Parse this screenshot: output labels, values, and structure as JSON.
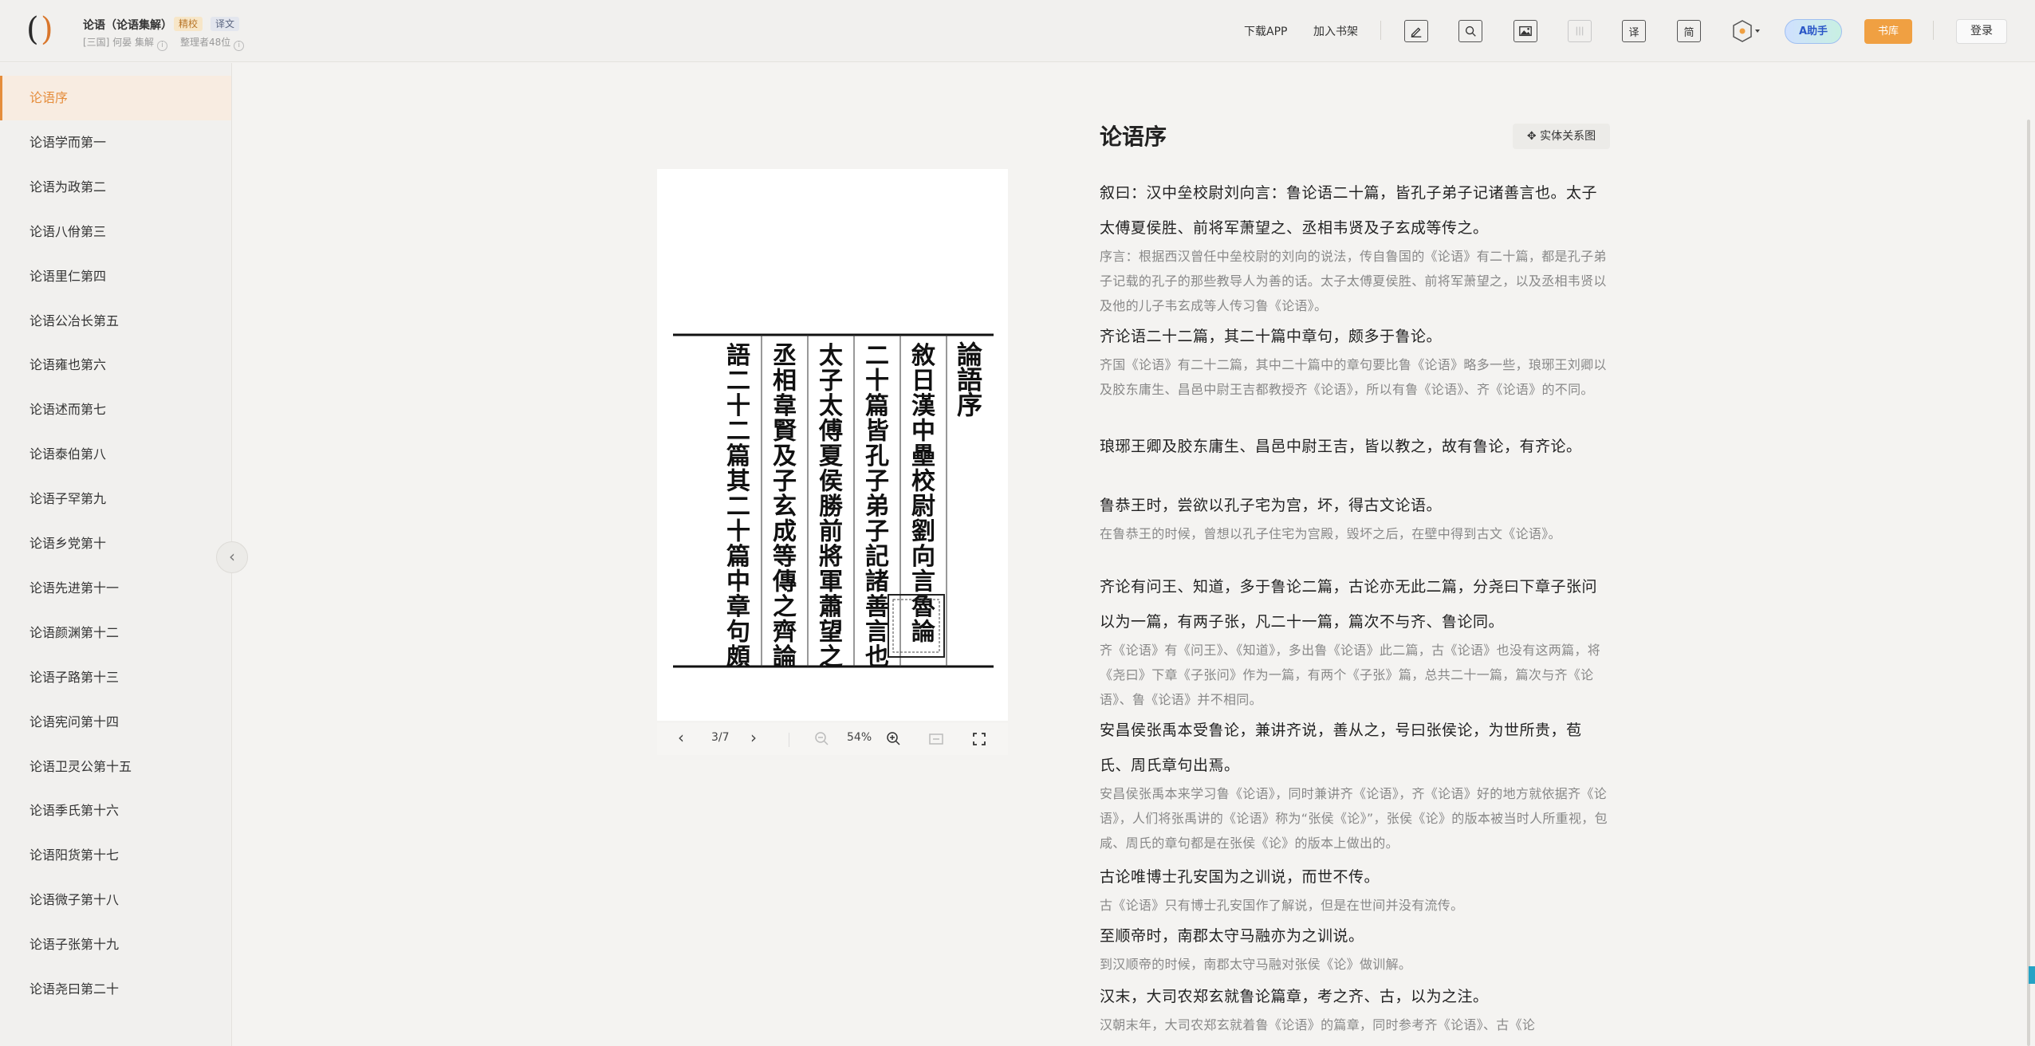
{
  "header": {
    "book_title": "论语（论语集解）",
    "tag_jingjiao": "精校",
    "tag_yiwen": "译文",
    "author": "[三国] 何晏 集解",
    "rank": "整理者48位",
    "info_icon": "i",
    "download_app": "下载APP",
    "add_shelf": "加入书架",
    "tool_yi": "译",
    "tool_jian": "简",
    "assistant": "A助手",
    "library": "书库",
    "login": "登录"
  },
  "sidebar": {
    "items": [
      {
        "label": "论语序",
        "active": true
      },
      {
        "label": "论语学而第一"
      },
      {
        "label": "论语为政第二"
      },
      {
        "label": "论语八佾第三"
      },
      {
        "label": "论语里仁第四"
      },
      {
        "label": "论语公冶长第五"
      },
      {
        "label": "论语雍也第六"
      },
      {
        "label": "论语述而第七"
      },
      {
        "label": "论语泰伯第八"
      },
      {
        "label": "论语子罕第九"
      },
      {
        "label": "论语乡党第十"
      },
      {
        "label": "论语先进第十一"
      },
      {
        "label": "论语颜渊第十二"
      },
      {
        "label": "论语子路第十三"
      },
      {
        "label": "论语宪问第十四"
      },
      {
        "label": "论语卫灵公第十五"
      },
      {
        "label": "论语季氏第十六"
      },
      {
        "label": "论语阳货第十七"
      },
      {
        "label": "论语微子第十八"
      },
      {
        "label": "论语子张第十九"
      },
      {
        "label": "论语尧曰第二十"
      }
    ],
    "collapse_glyph": "‹"
  },
  "viewer": {
    "scan_columns": [
      "論語序",
      "敘日漢中壘校尉劉向言魯論",
      "二十篇皆孔子弟子記諸善言也",
      "太子太傅夏侯勝前將軍蕭望之",
      "丞相韋賢及子玄成等傳之齊論",
      "語二十二篇其二十篇中章句頗"
    ],
    "page_indicator": "3/7",
    "zoom": "54%",
    "prev_glyph": "‹",
    "next_glyph": "›"
  },
  "content": {
    "title": "论语序",
    "relation_button": "实体关系图",
    "paragraphs": [
      {
        "orig": "叙曰：汉中垒校尉刘向言：鲁论语二十篇，皆孔子弟子记诸善言也。太子太傅夏侯胜、前将军萧望之、丞相韦贤及子玄成等传之。",
        "trans": "序言：根据西汉曾任中垒校尉的刘向的说法，传自鲁国的《论语》有二十篇，都是孔子弟子记载的孔子的那些教导人为善的话。太子太傅夏侯胜、前将军萧望之，以及丞相韦贤以及他的儿子韦玄成等人传习鲁《论语》。"
      },
      {
        "orig": "齐论语二十二篇，其二十篇中章句，颇多于鲁论。",
        "trans": "齐国《论语》有二十二篇，其中二十篇中的章句要比鲁《论语》略多一些，琅琊王刘卿以及胶东庸生、昌邑中尉王吉都教授齐《论语》，所以有鲁《论语》、齐《论语》的不同。"
      },
      {
        "orig": "琅琊王卿及胶东庸生、昌邑中尉王吉，皆以教之，故有鲁论，有齐论。",
        "trans": ""
      },
      {
        "orig": "鲁恭王时，尝欲以孔子宅为宫，坏，得古文论语。",
        "trans": "在鲁恭王的时候，曾想以孔子住宅为宫殿，毁坏之后，在壁中得到古文《论语》。"
      },
      {
        "orig": "齐论有问王、知道，多于鲁论二篇，古论亦无此二篇，分尧曰下章子张问以为一篇，有两子张，凡二十一篇，篇次不与齐、鲁论同。",
        "trans": "齐《论语》有《问王》、《知道》，多出鲁《论语》此二篇，古《论语》也没有这两篇，将《尧曰》下章《子张问》作为一篇，有两个《子张》篇，总共二十一篇，篇次与齐《论语》、鲁《论语》并不相同。"
      },
      {
        "orig": "安昌侯张禹本受鲁论，兼讲齐说，善从之，号曰张侯论，为世所贵，苞氏、周氏章句出焉。",
        "trans": "安昌侯张禹本来学习鲁《论语》，同时兼讲齐《论语》，齐《论语》好的地方就依据齐《论语》，人们将张禹讲的《论语》称为“张侯《论》”，张侯《论》的版本被当时人所重视，包咸、周氏的章句都是在张侯《论》的版本上做出的。"
      },
      {
        "orig": "古论唯博士孔安国为之训说，而世不传。",
        "trans": "古《论语》只有博士孔安国作了解说，但是在世间并没有流传。"
      },
      {
        "orig": "至顺帝时，南郡太守马融亦为之训说。",
        "trans": "到汉顺帝的时候，南郡太守马融对张侯《论》做训解。"
      },
      {
        "orig": "汉末，大司农郑玄就鲁论篇章，考之齐、古，以为之注。",
        "trans": "汉朝末年，大司农郑玄就着鲁《论语》的篇章，同时参考齐《论语》、古《论"
      }
    ]
  }
}
